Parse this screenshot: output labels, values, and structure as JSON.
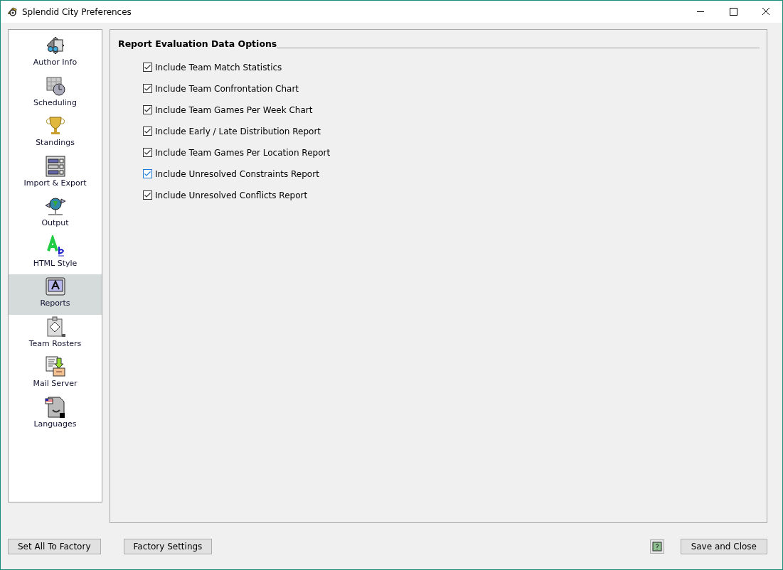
{
  "window": {
    "title": "Splendid City Preferences"
  },
  "sidebar": {
    "items": [
      {
        "label": "Author Info",
        "selected": false
      },
      {
        "label": "Scheduling",
        "selected": false
      },
      {
        "label": "Standings",
        "selected": false
      },
      {
        "label": "Import & Export",
        "selected": false
      },
      {
        "label": "Output",
        "selected": false
      },
      {
        "label": "HTML Style",
        "selected": false
      },
      {
        "label": "Reports",
        "selected": true
      },
      {
        "label": "Team Rosters",
        "selected": false
      },
      {
        "label": "Mail Server",
        "selected": false
      },
      {
        "label": "Languages",
        "selected": false
      }
    ]
  },
  "panel": {
    "title": "Report Evaluation Data Options",
    "options": [
      {
        "label": "Include Team Match Statistics",
        "checked": true,
        "focused": false
      },
      {
        "label": "Include Team Confrontation Chart",
        "checked": true,
        "focused": false
      },
      {
        "label": "Include Team Games Per Week Chart",
        "checked": true,
        "focused": false
      },
      {
        "label": "Include Early / Late Distribution Report",
        "checked": true,
        "focused": false
      },
      {
        "label": "Include Team Games Per Location Report",
        "checked": true,
        "focused": false
      },
      {
        "label": "Include Unresolved Constraints Report",
        "checked": true,
        "focused": true
      },
      {
        "label": "Include Unresolved Conflicts Report",
        "checked": true,
        "focused": false
      }
    ]
  },
  "buttons": {
    "left": [
      "Set All To Factory",
      "Factory Settings"
    ],
    "right": "Save and Close"
  }
}
